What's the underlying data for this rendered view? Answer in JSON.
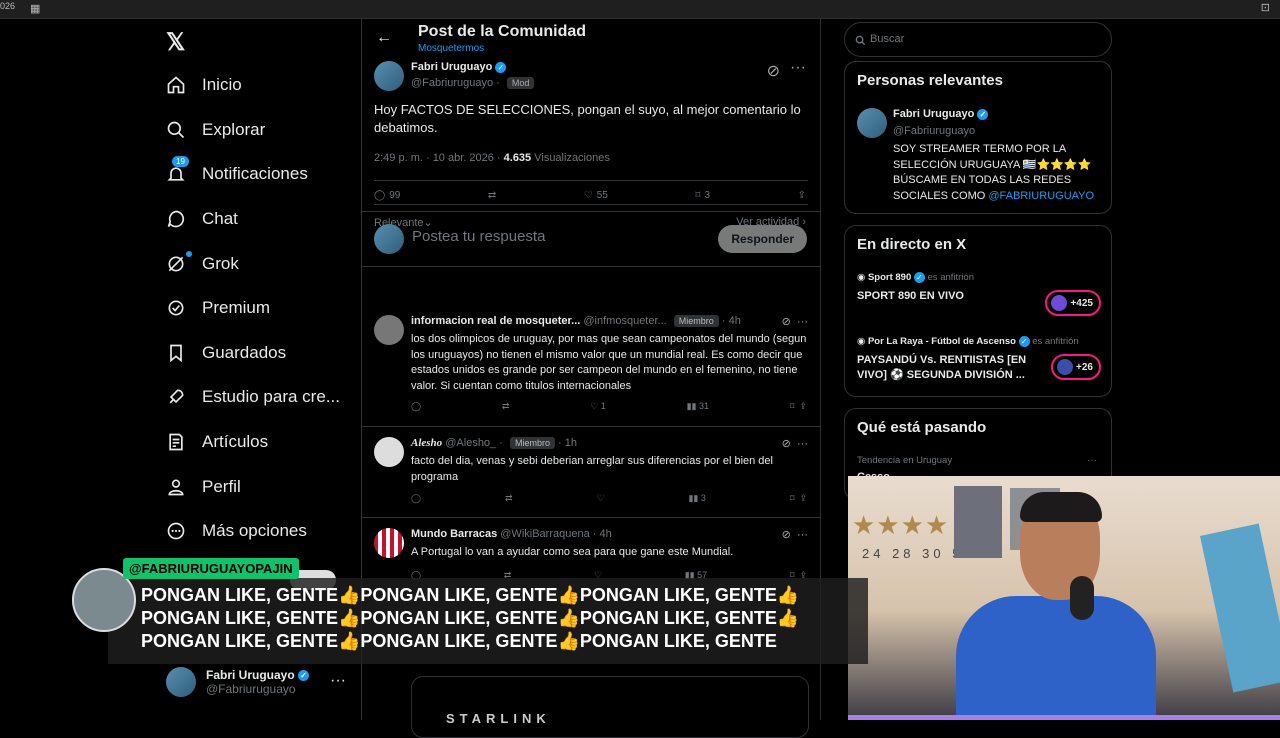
{
  "topbar": {
    "left_text": "026",
    "right_text": "⊡"
  },
  "nav": {
    "items": [
      {
        "name": "nav-home",
        "icon": "home-icon",
        "label": "Inicio"
      },
      {
        "name": "nav-explore",
        "icon": "search-icon",
        "label": "Explorar"
      },
      {
        "name": "nav-notifications",
        "icon": "bell-icon",
        "label": "Notificaciones",
        "badge": "19"
      },
      {
        "name": "nav-chat",
        "icon": "chat-icon",
        "label": "Chat"
      },
      {
        "name": "nav-grok",
        "icon": "grok-icon",
        "label": "Grok"
      },
      {
        "name": "nav-premium",
        "icon": "premium-icon",
        "label": "Premium"
      },
      {
        "name": "nav-bookmarks",
        "icon": "bookmark-icon",
        "label": "Guardados"
      },
      {
        "name": "nav-studio",
        "icon": "rocket-icon",
        "label": "Estudio para cre..."
      },
      {
        "name": "nav-articles",
        "icon": "article-icon",
        "label": "Artículos"
      },
      {
        "name": "nav-profile",
        "icon": "person-icon",
        "label": "Perfil"
      },
      {
        "name": "nav-more",
        "icon": "more-circle-icon",
        "label": "Más opciones"
      }
    ],
    "account": {
      "name": "Fabri Uruguayo",
      "handle": "@Fabriuruguayo",
      "more": "···"
    }
  },
  "header": {
    "title": "Post de la Comunidad",
    "subtitle": "Mosquetermos"
  },
  "post": {
    "author": "Fabri Uruguayo",
    "handle": "@Fabriuruguayo",
    "sep": "·",
    "role": "Mod",
    "text": "Hoy FACTOS DE SELECCIONES, pongan el suyo, al mejor comentario lo debatimos.",
    "time": "2:49 p. m. · 10 abr. 2026 ·",
    "views": "4.635",
    "views_label": "Visualizaciones",
    "replies": "99",
    "likes": "55",
    "bookmarks": "3",
    "sort": "Relevante",
    "activity": "Ver actividad"
  },
  "reply": {
    "placeholder": "Postea tu respuesta",
    "button": "Responder"
  },
  "comments": [
    {
      "name": "informacion real de mosqueter...",
      "handle": "@infmosqueter...",
      "badge": "Miembro",
      "time": "· 4h",
      "text": "los dos olimpicos de uruguay, por mas que sean campeonatos del mundo (segun los uruguayos) no tienen el mismo valor que un mundial real. Es como decir que estados unidos es grande por ser campeon del mundo en el femenino, no tiene valor. Si cuentan como titulos internacionales",
      "likes": "1",
      "views": "31"
    },
    {
      "name": "Alesho",
      "handle": "@Alesho_ ·",
      "badge": "Miembro",
      "time": "· 1h",
      "text": "facto del dia, venas y sebi deberian arreglar sus diferencias por el bien del programa",
      "likes": "",
      "views": "3"
    },
    {
      "name": "Mundo Barracas",
      "handle": "@WikiBarraquena",
      "badge": "",
      "time": "· 4h",
      "text": "A Portugal lo van a ayudar como sea para que gane este Mundial.",
      "likes": "",
      "views": "57"
    }
  ],
  "ad": {
    "brand": "STARLINK"
  },
  "search": {
    "placeholder": "Buscar"
  },
  "relevant": {
    "title": "Personas relevantes",
    "name": "Fabri Uruguayo",
    "handle": "@Fabriuruguayo",
    "bio": "SOY STREAMER TERMO POR LA SELECCIÓN URUGUAYA 🇺🇾⭐⭐⭐⭐ BÚSCAME EN TODAS LAS REDES SOCIALES COMO",
    "mention": "@FABRIURUGUAYO"
  },
  "live": {
    "title": "En directo en X",
    "items": [
      {
        "host": "Sport 890",
        "host_suffix": "es anfitrión",
        "title": "SPORT 890 EN VIVO",
        "count": "+425"
      },
      {
        "host": "Por La Raya - Fútbol de Ascenso",
        "host_suffix": "es anfitrión",
        "title": "PAYSANDÚ Vs. RENTIISTAS  [EN VIVO] ⚽ SEGUNDA DIVISIÓN ...",
        "count": "+26"
      }
    ]
  },
  "trends": {
    "title": "Qué está pasando",
    "label": "Tendencia en Uruguay",
    "more": "···",
    "name": "Cesso"
  },
  "chat_overlay": {
    "username": "@FABRIURUGUAYOPAJIN",
    "message": "PONGAN LIKE, GENTE👍PONGAN LIKE, GENTE👍PONGAN LIKE, GENTE👍PONGAN LIKE, GENTE👍PONGAN LIKE, GENTE👍PONGAN LIKE, GENTE👍PONGAN LIKE, GENTE👍PONGAN LIKE, GENTE👍PONGAN LIKE, GENTE"
  },
  "webcam": {
    "numbers": "24 28 30 50"
  },
  "colors": {
    "accent": "#1d9bf0",
    "background": "#000000",
    "border": "#2f3336",
    "muted": "#71767b",
    "chat_user_bg": "#12c26b",
    "live_pill": "#f91880"
  }
}
